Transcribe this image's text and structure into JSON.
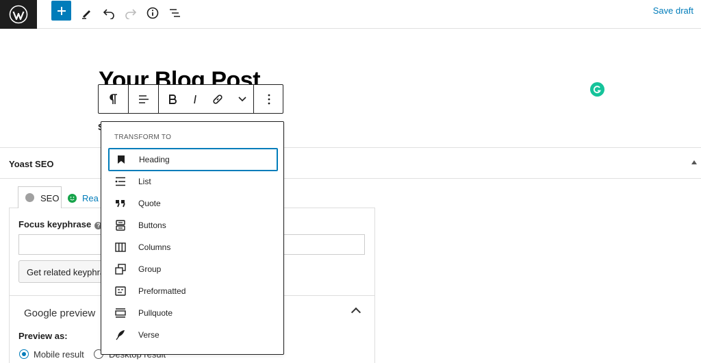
{
  "topbar": {
    "save_draft": "Save draft"
  },
  "editor": {
    "post_title": "Your Blog Post",
    "paragraph_start": "S"
  },
  "transform_menu": {
    "heading": "Transform to",
    "items": [
      {
        "label": "Heading",
        "icon": "bookmark-icon",
        "selected": true
      },
      {
        "label": "List",
        "icon": "list-icon"
      },
      {
        "label": "Quote",
        "icon": "quote-icon"
      },
      {
        "label": "Buttons",
        "icon": "buttons-icon"
      },
      {
        "label": "Columns",
        "icon": "columns-icon"
      },
      {
        "label": "Group",
        "icon": "group-icon"
      },
      {
        "label": "Preformatted",
        "icon": "preformatted-icon"
      },
      {
        "label": "Pullquote",
        "icon": "pullquote-icon"
      },
      {
        "label": "Verse",
        "icon": "feather-icon"
      }
    ]
  },
  "yoast": {
    "title": "Yoast SEO",
    "tabs": {
      "seo": "SEO",
      "readability": "Rea"
    },
    "focus_keyphrase_label": "Focus keyphrase",
    "focus_keyphrase_value": "",
    "related_button": "Get related keyphrases",
    "google_preview": "Google preview",
    "preview_as": "Preview as:",
    "mobile_result": "Mobile result",
    "desktop_result": "Desktop result"
  },
  "colors": {
    "accent": "#007cba",
    "dark": "#1e1e1e",
    "grammarly": "#15c39a"
  }
}
